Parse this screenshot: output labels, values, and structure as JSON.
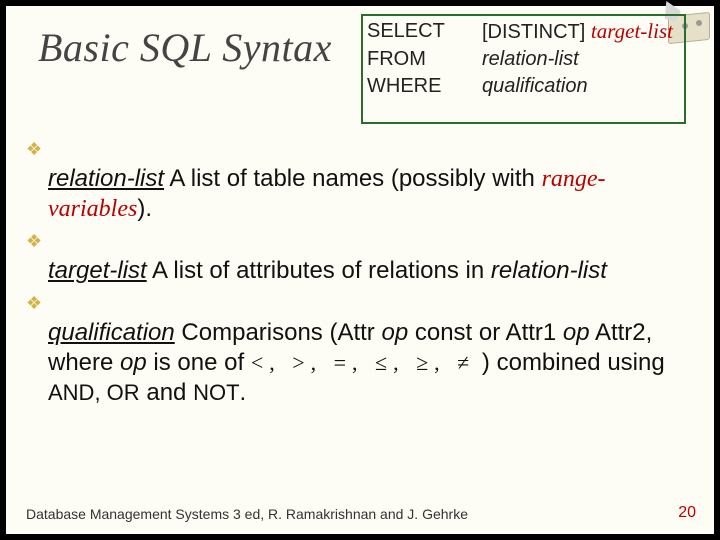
{
  "title": "Basic SQL Syntax",
  "syntax": {
    "rows": [
      {
        "kw": "SELECT",
        "opt": "[DISTINCT]",
        "arg": "target-list"
      },
      {
        "kw": "FROM",
        "opt": "",
        "arg": "relation-list"
      },
      {
        "kw": "WHERE",
        "opt": "",
        "arg": "qualification"
      }
    ]
  },
  "bullets": {
    "b1_term": "relation-list",
    "b1_a": "  A list of table names (possibly with ",
    "b1_red": "range-variables",
    "b1_b": ").",
    "b2_term": "target-list",
    "b2_a": "  A list of attributes of relations in ",
    "b2_ital": "relation-list",
    "b3_term": "qualification",
    "b3_a": "  Comparisons (Attr ",
    "b3_op1": "op",
    "b3_b": " const or Attr1 ",
    "b3_op2": "op",
    "b3_c": " Attr2, where ",
    "b3_op3": "op",
    "b3_d": " is one of ",
    "b3_math": "<, >, =, ≤, ≥, ≠",
    "b3_e": " ) combined using ",
    "b3_sc1": "AND, OR",
    "b3_f": " and ",
    "b3_sc2": "NOT",
    "b3_g": "."
  },
  "footer": "Database Management Systems 3 ed,  R. Ramakrishnan and J. Gehrke",
  "page": "20",
  "glyphs": {
    "diamond": "❖"
  }
}
